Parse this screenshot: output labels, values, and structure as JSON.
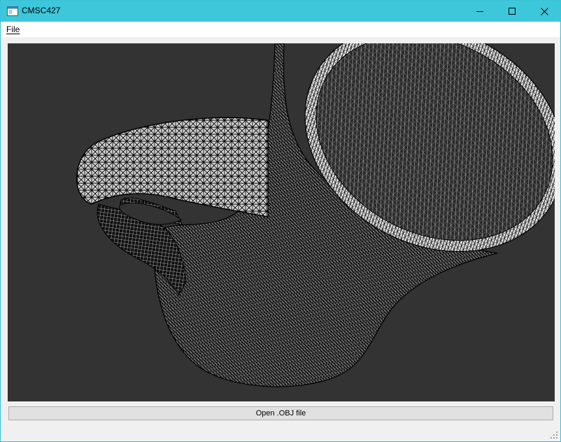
{
  "window": {
    "title": "CMSC427",
    "controls": {
      "minimize": "minimize",
      "maximize": "maximize",
      "close": "close"
    }
  },
  "menu": {
    "items": [
      {
        "label": "File",
        "mnemonic": "F"
      }
    ]
  },
  "viewport": {
    "background": "#333333",
    "wire_color": "#000000",
    "surface_color": "#d8d8d8",
    "content": "wireframe teapot mesh"
  },
  "actions": {
    "open_button": "Open .OBJ file"
  },
  "colors": {
    "titlebar": "#3cc8da",
    "menubar": "#ffffff",
    "window_bg": "#f0f0f0",
    "button_bg": "#e1e1e1",
    "button_border": "#adadad"
  }
}
